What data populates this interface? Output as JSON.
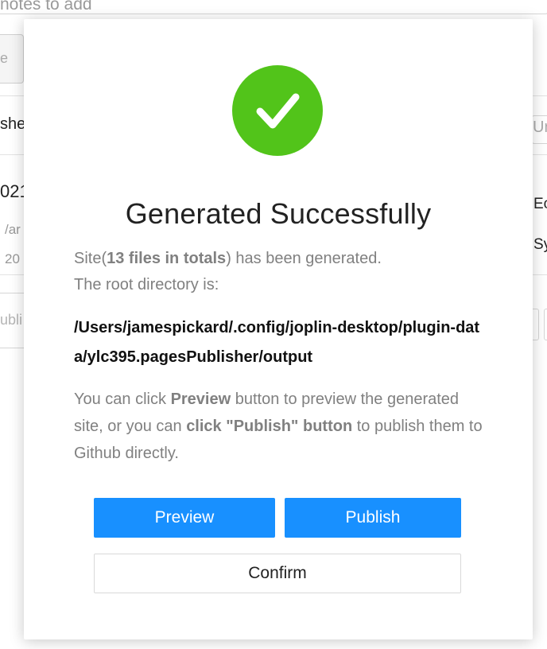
{
  "background": {
    "search_placeholder": "notes to add",
    "left_button_label": "e",
    "tab_left_label": "she",
    "tab_right_label": "Ur",
    "item_date_partial": "021",
    "item_path_partial": "/ar",
    "item_year_partial": "20",
    "right_label_1": "Ec",
    "right_label_2": "Sy",
    "left_input_text": "ubli"
  },
  "modal": {
    "status_icon": "check-circle-icon",
    "title": "Generated Successfully",
    "desc_prefix": "Site(",
    "desc_count": "13 files in totals",
    "desc_suffix": ") has been generated.",
    "desc_line2": "The root directory is:",
    "root_path": "/Users/jamespickard/.config/joplin-desktop/plugin-data/ylc395.pagesPublisher/output",
    "hint_part1": "You can click ",
    "hint_preview": "Preview",
    "hint_part2": " button to preview the generated site, or you can ",
    "hint_publish": "click \"Publish\" button",
    "hint_part3": " to publish them to Github directly.",
    "buttons": {
      "preview": "Preview",
      "publish": "Publish",
      "confirm": "Confirm"
    }
  },
  "colors": {
    "success_green": "#52c41a",
    "primary_blue": "#1890ff"
  }
}
